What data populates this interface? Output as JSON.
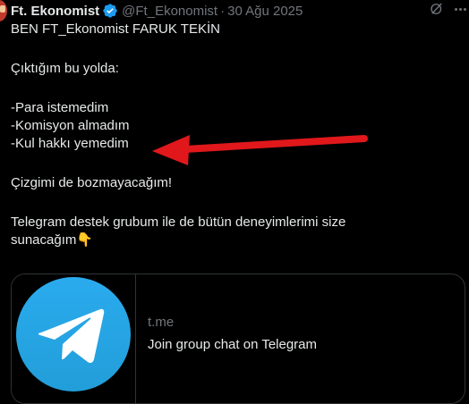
{
  "tweet": {
    "author_name": "Ft. Ekonomist",
    "handle": "@Ft_Ekonomist",
    "separator": "·",
    "date": "30 Ağu 2025",
    "lines": [
      "BEN FT_Ekonomist FARUK TEKİN",
      "Çıktığım bu yolda:",
      "-Para istemedim",
      "-Komisyon almadım",
      "-Kul hakkı yemedim",
      "Çizgimi de bozmayacağım!",
      "Telegram destek grubum ile de bütün deneyimlerimi size",
      "sunacağım👇"
    ]
  },
  "link_card": {
    "domain": "t.me",
    "title": "Join group chat on Telegram"
  },
  "colors": {
    "background": "#000000",
    "text": "#e7e9ea",
    "muted": "#71767b",
    "verified": "#1d9bf0",
    "telegram": "#2AABEE",
    "arrow": "#e0181b"
  },
  "icons": [
    "verified-badge-icon",
    "grok-icon",
    "more-icon",
    "telegram-logo-icon",
    "red-arrow-annotation"
  ]
}
